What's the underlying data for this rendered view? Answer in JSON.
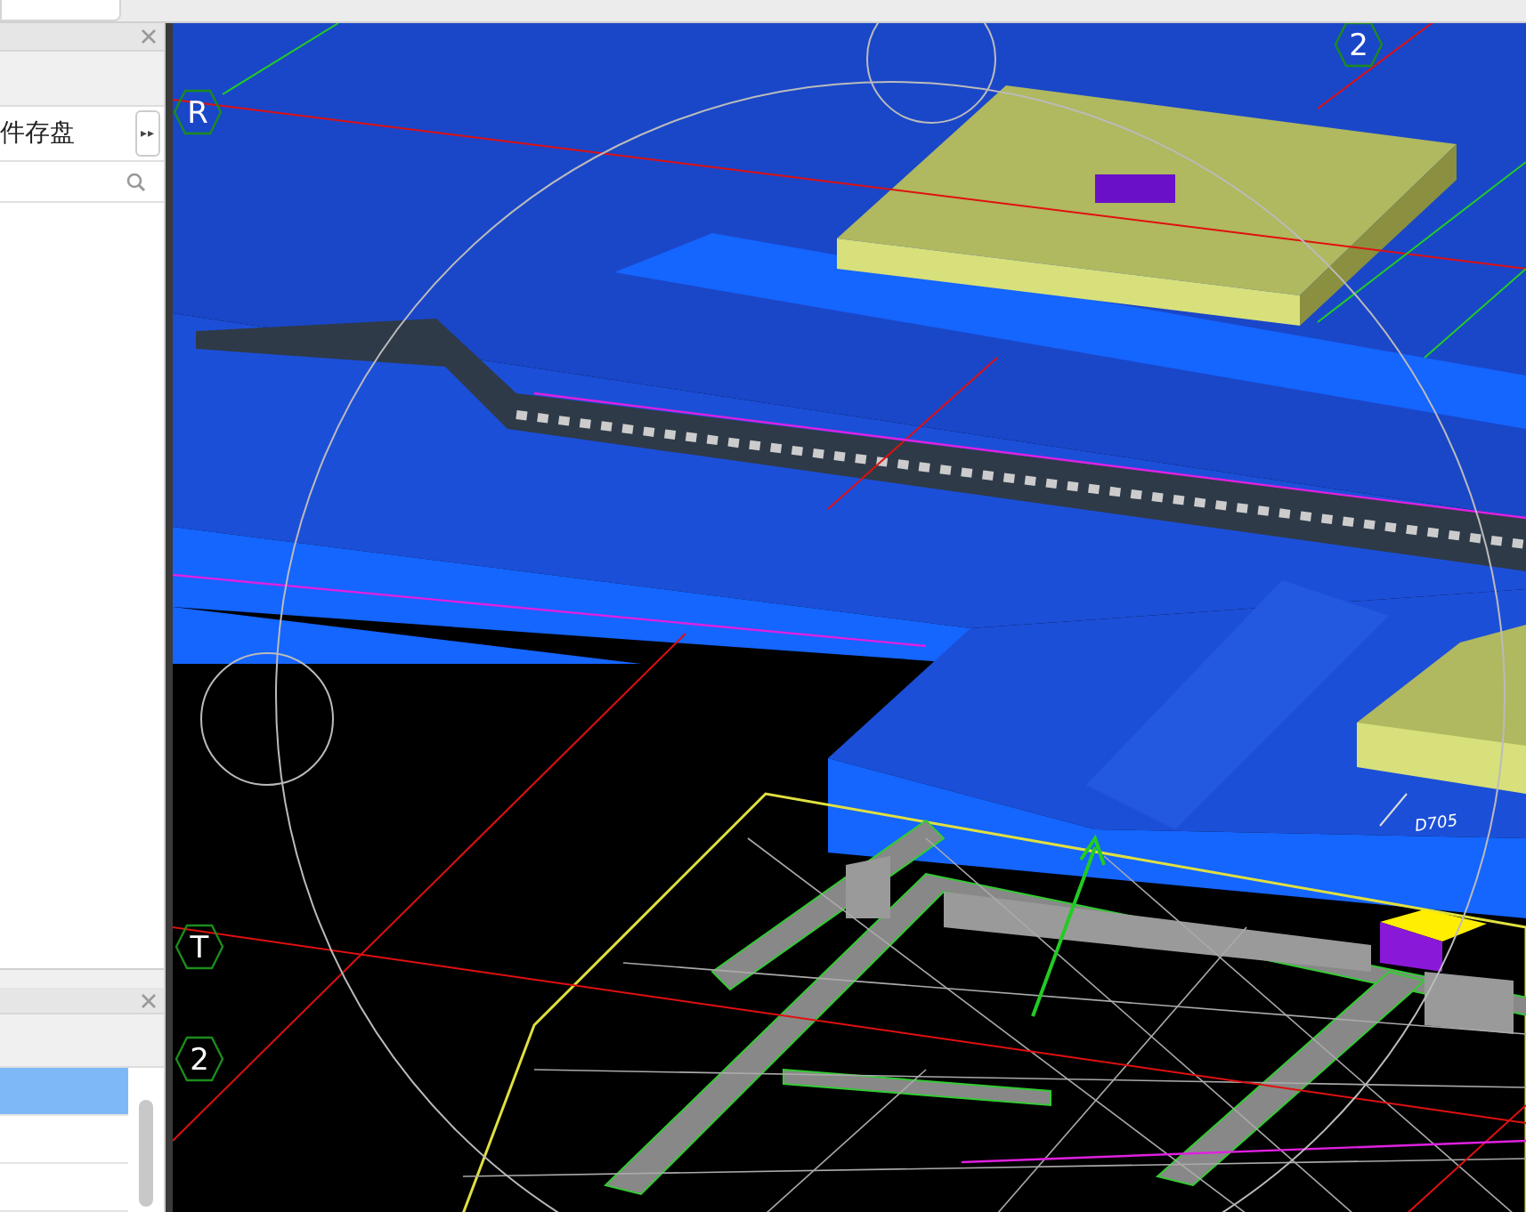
{
  "left_panel": {
    "row_text": "件存盘",
    "toggle_symbol": "▸▸"
  },
  "bottom_panel": {
    "rows": [
      {
        "selected": true
      },
      {
        "selected": false
      },
      {
        "selected": false
      }
    ]
  },
  "viewport": {
    "axis_labels": [
      "2",
      "R",
      "T",
      "2"
    ],
    "dimension_label": "D705"
  }
}
